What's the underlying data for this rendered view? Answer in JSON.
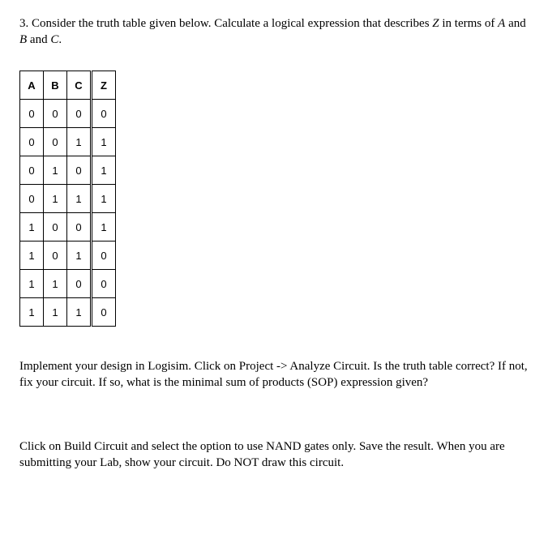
{
  "question": {
    "number": "3.",
    "text_before_Z": "Consider the truth table given below. Calculate a logical expression that describes ",
    "var_Z": "Z",
    "text_mid": " in terms of ",
    "var_A": "A",
    "and1": " and ",
    "var_B": "B",
    "and2": " and ",
    "var_C": "C",
    "period": "."
  },
  "table": {
    "headers": [
      "A",
      "B",
      "C",
      "Z"
    ],
    "rows": [
      [
        "0",
        "0",
        "0",
        "0"
      ],
      [
        "0",
        "0",
        "1",
        "1"
      ],
      [
        "0",
        "1",
        "0",
        "1"
      ],
      [
        "0",
        "1",
        "1",
        "1"
      ],
      [
        "1",
        "0",
        "0",
        "1"
      ],
      [
        "1",
        "0",
        "1",
        "0"
      ],
      [
        "1",
        "1",
        "0",
        "0"
      ],
      [
        "1",
        "1",
        "1",
        "0"
      ]
    ]
  },
  "para1": "Implement your design in Logisim. Click on Project -> Analyze Circuit. Is the truth table correct? If not, fix your circuit. If so, what is the minimal sum of products (SOP) expression given?",
  "para2": "Click on Build Circuit and select the option to use NAND gates only. Save the result. When you are submitting your Lab, show your circuit. Do NOT draw this circuit."
}
